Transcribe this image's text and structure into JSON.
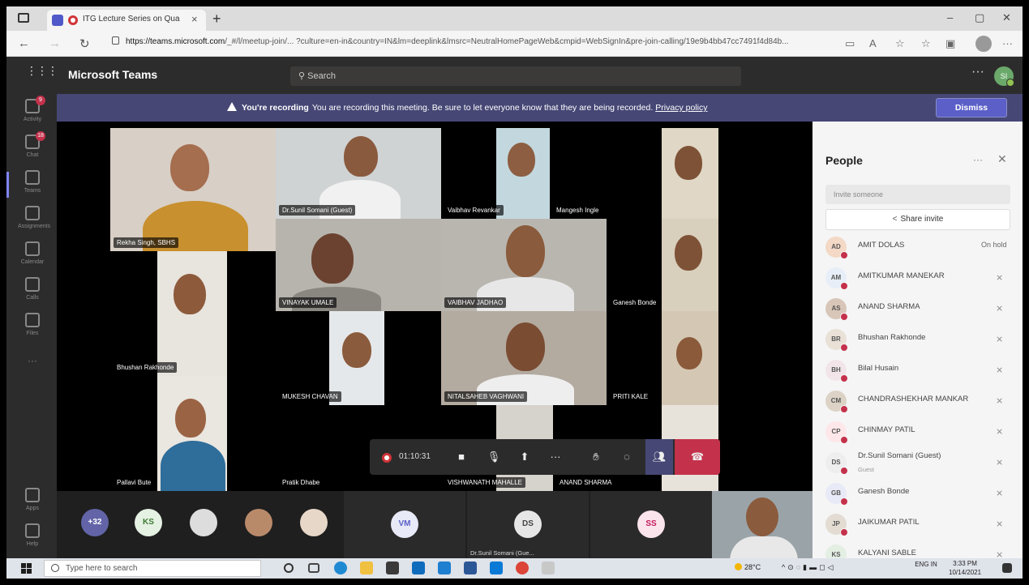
{
  "browser": {
    "tab_title": "ITG Lecture Series on Qua...",
    "tab_close": "×",
    "new_tab": "+",
    "url_host": "https://teams.microsoft.com",
    "url_rest": "/_#/l/meetup-join/... ?culture=en-in&country=IN&lm=deeplink&lmsrc=NeutralHomePageWeb&cmpid=WebSignIn&pre-join-calling/19e9b4bb47cc7491f4d84b...",
    "minimize": "–",
    "restore": "▢",
    "close": "✕"
  },
  "teams": {
    "title": "Microsoft Teams",
    "search_placeholder": "Search",
    "more": "···",
    "me_initials": "SI"
  },
  "rail": [
    {
      "label": "Activity",
      "badge": "9"
    },
    {
      "label": "Chat",
      "badge": "18"
    },
    {
      "label": "Teams",
      "badge": ""
    },
    {
      "label": "Assignments",
      "badge": ""
    },
    {
      "label": "Calendar",
      "badge": ""
    },
    {
      "label": "Calls",
      "badge": ""
    },
    {
      "label": "Files",
      "badge": ""
    },
    {
      "label": "···",
      "badge": ""
    },
    {
      "label": "Apps",
      "badge": ""
    },
    {
      "label": "Help",
      "badge": ""
    }
  ],
  "banner": {
    "bold": "You're recording",
    "text": "You are recording this meeting. Be sure to let everyone know that they are being recorded.",
    "privacy": "Privacy policy",
    "dismiss": "Dismiss"
  },
  "video_tiles": [
    {
      "name": "Rekha Singh, SBHS"
    },
    {
      "name": "Dr.Sunil Somani (Guest)"
    },
    {
      "name": "Vaibhav Revankar"
    },
    {
      "name": "Mangesh Ingle"
    },
    {
      "name": "VINAYAK UMALE"
    },
    {
      "name": "VAIBHAV JADHAO"
    },
    {
      "name": "Ganesh Bonde"
    },
    {
      "name": "Bhushan Rakhonde"
    },
    {
      "name": "MUKESH CHAVAN"
    },
    {
      "name": "NITALSAHEB VAGHWANI"
    },
    {
      "name": "PRITI KALE"
    },
    {
      "name": "Pallavi Bute"
    },
    {
      "name": "Pratik Dhabe"
    },
    {
      "name": "VISHWANATH MAHALLE"
    },
    {
      "name": "ANAND SHARMA"
    }
  ],
  "controls": {
    "timer": "01:10:31",
    "more": "···"
  },
  "strip": {
    "overflow": "+32",
    "avatars": [
      "KS",
      "VM",
      "DS",
      "SS"
    ],
    "ds_name": "Dr.Sunil Somani (Gue..."
  },
  "people": {
    "title": "People",
    "more": "···",
    "close": "✕",
    "invite_placeholder": "Invite someone",
    "share_invite": "Share invite",
    "list": [
      {
        "initials": "AD",
        "name": "AMIT DOLAS",
        "status": "On hold",
        "sub": ""
      },
      {
        "initials": "AM",
        "name": "AMITKUMAR MANEKAR",
        "status": "",
        "sub": ""
      },
      {
        "initials": "AS",
        "name": "ANAND SHARMA",
        "status": "",
        "sub": ""
      },
      {
        "initials": "BR",
        "name": "Bhushan Rakhonde",
        "status": "",
        "sub": ""
      },
      {
        "initials": "BH",
        "name": "Bilal Husain",
        "status": "",
        "sub": ""
      },
      {
        "initials": "CM",
        "name": "CHANDRASHEKHAR MANKAR",
        "status": "",
        "sub": ""
      },
      {
        "initials": "CP",
        "name": "CHINMAY PATIL",
        "status": "",
        "sub": ""
      },
      {
        "initials": "DS",
        "name": "Dr.Sunil Somani (Guest)",
        "status": "",
        "sub": "Guest"
      },
      {
        "initials": "GB",
        "name": "Ganesh Bonde",
        "status": "",
        "sub": ""
      },
      {
        "initials": "JP",
        "name": "JAIKUMAR PATIL",
        "status": "",
        "sub": ""
      },
      {
        "initials": "KS",
        "name": "KALYANI SABLE",
        "status": "",
        "sub": ""
      }
    ]
  },
  "taskbar": {
    "search_placeholder": "Type here to search",
    "weather": "28°C",
    "lang": "ENG IN",
    "time": "3:33 PM",
    "date": "10/14/2021"
  }
}
